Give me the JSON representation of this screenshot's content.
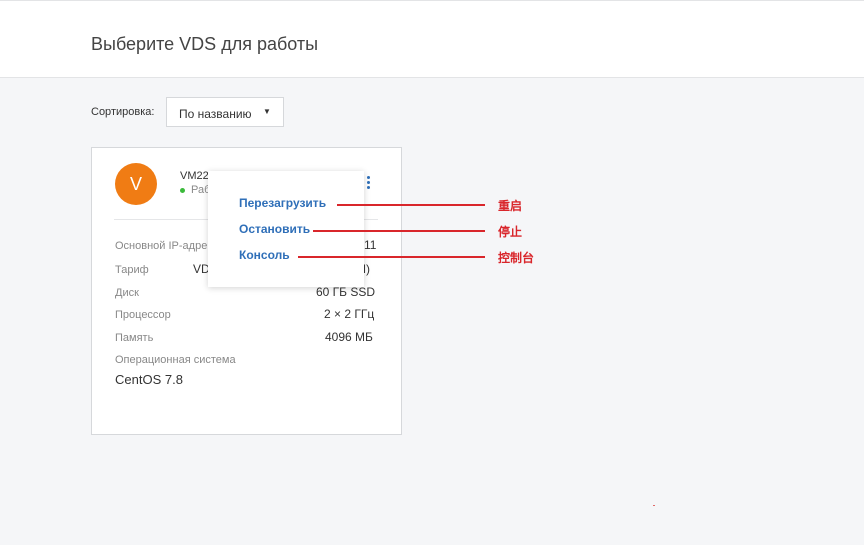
{
  "header": {
    "title": "Выберите VDS для работы"
  },
  "sort": {
    "label": "Сортировка:",
    "value": "По названию",
    "caret": "▼"
  },
  "vm": {
    "avatar_letter": "V",
    "name": "VM22",
    "status": "Раб",
    "rows": [
      {
        "label": "Основной IP-адре",
        "value": "11"
      },
      {
        "label": "Тариф",
        "value_left": "VD",
        "value": "M)"
      },
      {
        "label": "Диск",
        "value": "60 ГБ SSD"
      },
      {
        "label": "Процессор",
        "value": "2 × 2 ГГц"
      },
      {
        "label": "Память",
        "value": "4096 МБ"
      }
    ],
    "os_label": "Операционная система",
    "os_value": "CentOS 7.8"
  },
  "menu": {
    "items": [
      {
        "label": "Перезагрузить"
      },
      {
        "label": "Остановить"
      },
      {
        "label": "Консоль"
      }
    ]
  },
  "annotations": {
    "items": [
      {
        "label": "重启"
      },
      {
        "label": "停止"
      },
      {
        "label": "控制台"
      }
    ],
    "color": "#d9262b"
  },
  "colors": {
    "accent": "#2f6fb8",
    "avatar": "#f07c14",
    "status": "#3bba3b"
  }
}
